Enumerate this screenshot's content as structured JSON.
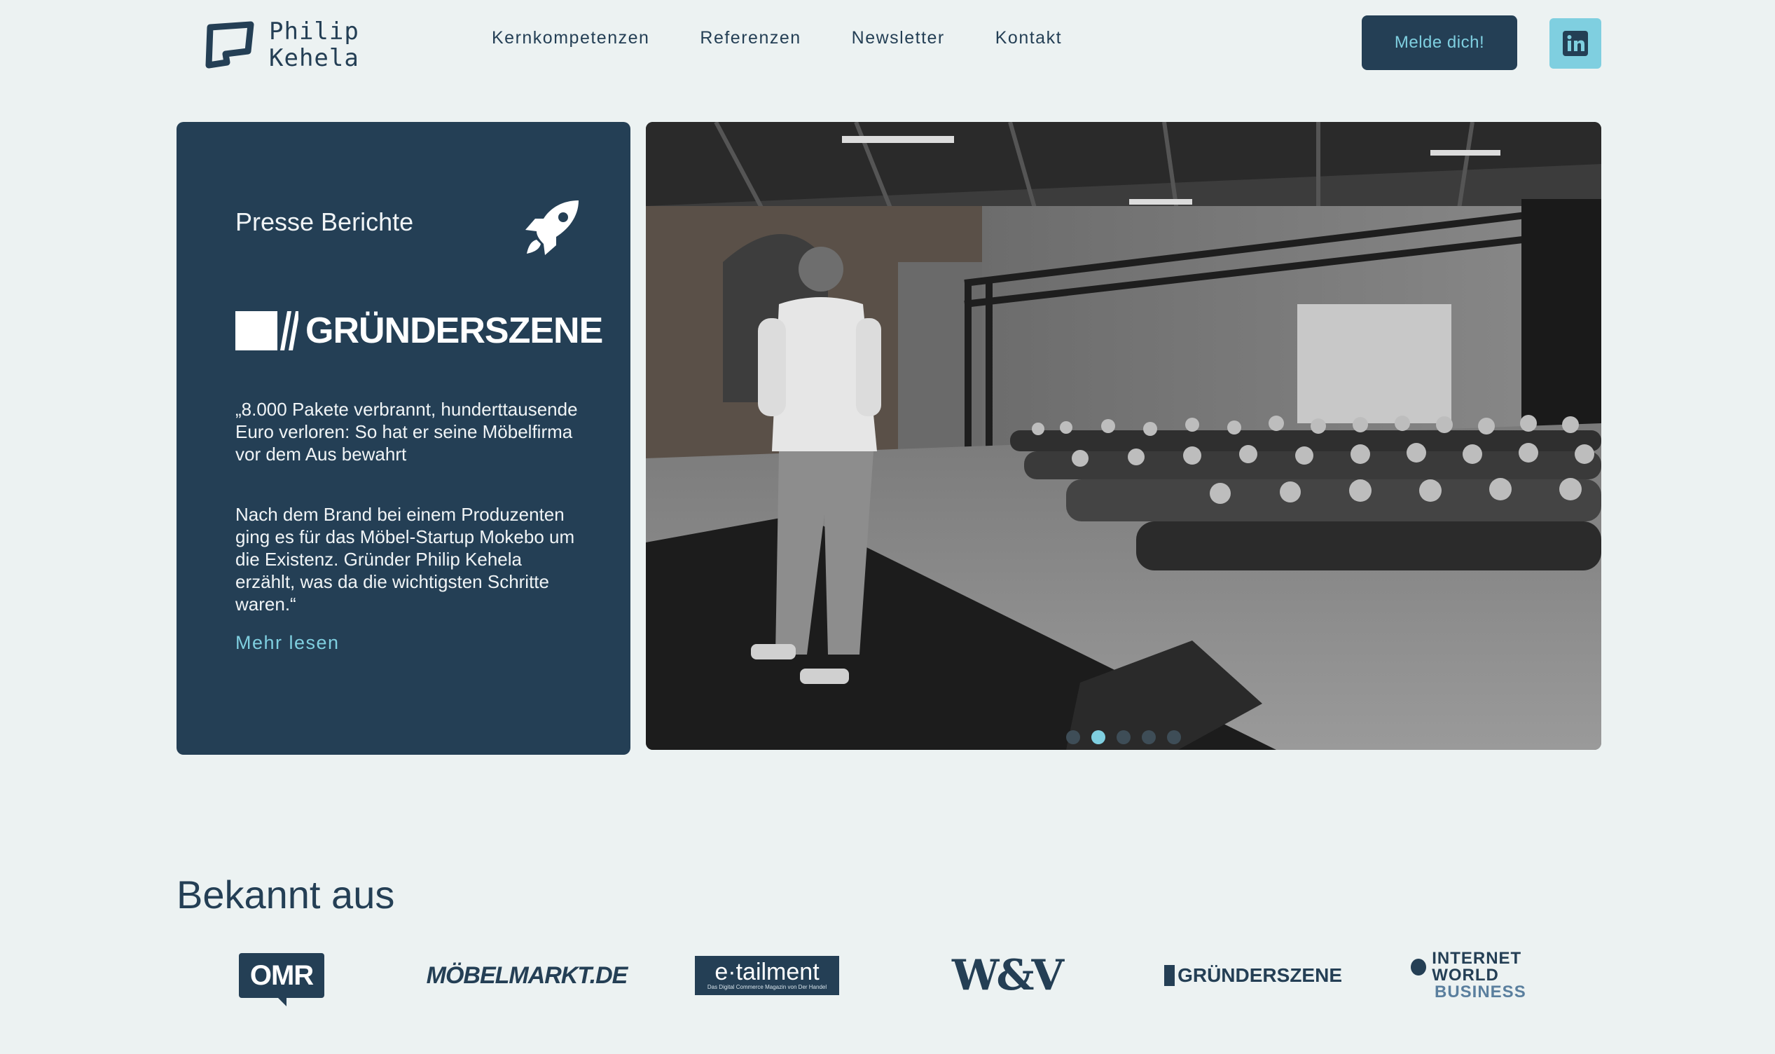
{
  "header": {
    "logo_line1": "Philip",
    "logo_line2": "Kehela",
    "nav": [
      "Kernkompetenzen",
      "Referenzen",
      "Newsletter",
      "Kontakt"
    ],
    "cta_label": "Melde dich!",
    "linkedin_icon": "linkedin-icon"
  },
  "press": {
    "title": "Presse Berichte",
    "icon": "rocket-icon",
    "source_logo": "GRÜNDERSZENE",
    "quote": "„8.000 Pakete verbrannt, hunderttausende Euro verloren: So hat er seine Möbelfirma vor dem Aus bewahrt",
    "body": "Nach dem Brand bei einem Produzenten ging es für das Möbel-Startup Mokebo um die Existenz. Gründer Philip Kehela erzählt, was da die wichtigsten Schritte waren.“",
    "more_label": "Mehr lesen"
  },
  "carousel": {
    "slide_count": 5,
    "active_index": 1
  },
  "known": {
    "title": "Bekannt aus",
    "logos": {
      "omr": "OMR",
      "moebelmarkt": "MÖBELMARKT.DE",
      "etailment": "e·tailment",
      "etailment_sub": "Das Digital Commerce Magazin von Der Handel",
      "wv": "W&V",
      "gruenderszene": "GRÜNDERSZENE",
      "iw_line1": "INTERNET WORLD",
      "iw_line2": "BUSINESS"
    }
  },
  "colors": {
    "background": "#ecf2f2",
    "navy": "#243f55",
    "accent": "#7fcfe0"
  }
}
